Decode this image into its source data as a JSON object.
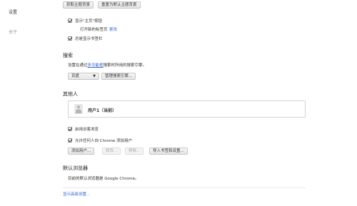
{
  "sidebar": {
    "items": [
      {
        "label": "设置"
      },
      {
        "label": "关于"
      }
    ]
  },
  "appearance": {
    "get_theme_button": "获取主题背景",
    "reset_theme_button": "重置为默认主题背景",
    "show_home_button_label": "显示\"主页\"按钮",
    "new_tab_text": "打开新的标签页",
    "change_link": "更改",
    "always_show_bookmarks_label": "总是显示书签栏"
  },
  "search": {
    "title": "搜索",
    "desc_prefix": "设置在通过",
    "desc_link": "多功能框",
    "desc_suffix": "搜索时所用的搜索引擎。",
    "engine_value": "百度",
    "manage_button": "管理搜索引擎..."
  },
  "people": {
    "title": "其他人",
    "current_user": "用户1（当前）",
    "guest_browsing_label": "启用访客浏览",
    "allow_add_person_label": "允许任何人向 Chrome 添加用户",
    "add_user_button": "添加用户...",
    "edit_button": "修改...",
    "remove_button": "移除...",
    "import_button": "导入书签和设置..."
  },
  "default_browser": {
    "title": "默认浏览器",
    "desc": "目前的默认浏览器是 Google Chrome。"
  },
  "show_advanced_link": "显示高级设置..."
}
